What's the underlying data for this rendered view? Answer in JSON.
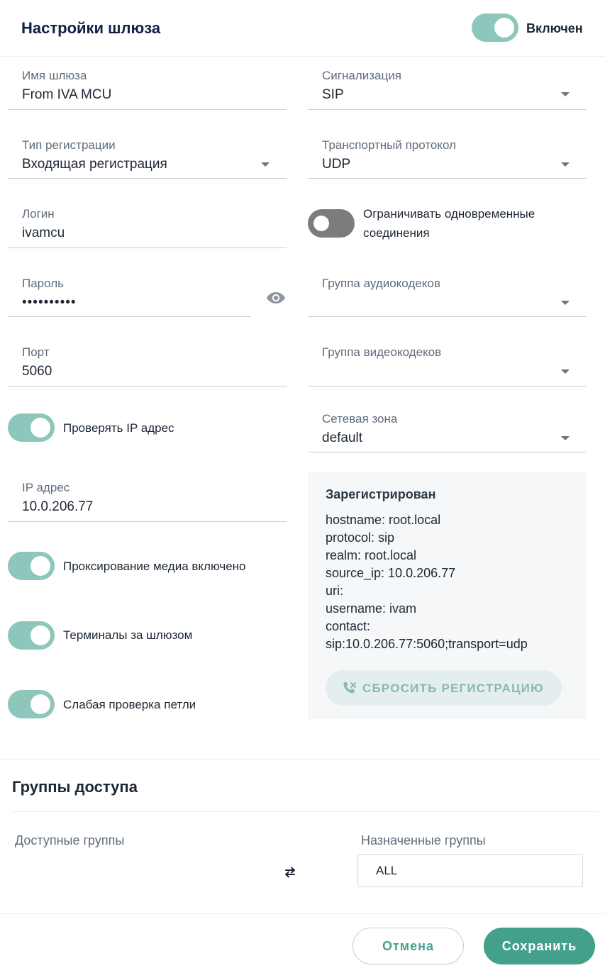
{
  "header": {
    "title": "Настройки шлюза",
    "enabled_label": "Включен",
    "enabled": true
  },
  "left": {
    "gateway_name": {
      "label": "Имя шлюза",
      "value": "From IVA MCU"
    },
    "registration_type": {
      "label": "Тип регистрации",
      "value": "Входящая регистрация"
    },
    "login": {
      "label": "Логин",
      "value": "ivamcu"
    },
    "password": {
      "label": "Пароль",
      "value": "••••••••••"
    },
    "port": {
      "label": "Порт",
      "value": "5060"
    },
    "check_ip": {
      "label": "Проверять IP адрес",
      "enabled": true
    },
    "ip_address": {
      "label": "IP адрес",
      "value": "10.0.206.77"
    },
    "media_proxy": {
      "label": "Проксирование медиа включено",
      "enabled": true
    },
    "terminals_behind": {
      "label": "Терминалы за шлюзом",
      "enabled": true
    },
    "weak_loop_check": {
      "label": "Слабая проверка петли",
      "enabled": true
    }
  },
  "right": {
    "signaling": {
      "label": "Сигнализация",
      "value": "SIP"
    },
    "transport": {
      "label": "Транспортный протокол",
      "value": "UDP"
    },
    "limit_connections": {
      "label": "Ограничивать одновременные соединения",
      "enabled": false
    },
    "audio_codecs": {
      "label": "Группа аудиокодеков",
      "value": ""
    },
    "video_codecs": {
      "label": "Группа видеокодеков",
      "value": ""
    },
    "network_zone": {
      "label": "Сетевая зона",
      "value": "default"
    }
  },
  "registration": {
    "title": "Зарегистрирован",
    "lines": [
      "hostname: root.local",
      "protocol: sip",
      "realm: root.local",
      "source_ip: 10.0.206.77",
      "uri:",
      "username: ivam",
      "contact:",
      "sip:10.0.206.77:5060;transport=udp"
    ],
    "reset_label": "СБРОСИТЬ РЕГИСТРАЦИЮ"
  },
  "access": {
    "title": "Группы доступа",
    "available_label": "Доступные группы",
    "assigned_label": "Назначенные группы",
    "assigned_items": [
      "ALL"
    ]
  },
  "footer": {
    "cancel_label": "Отмена",
    "save_label": "Сохранить"
  },
  "colors": {
    "accent": "#42a08b",
    "toggle_on": "#8dc7bb",
    "toggle_off": "#7c7c7c",
    "title": "#132045"
  },
  "icons": {
    "visibility": "eye-icon",
    "reset": "phone-reset-icon",
    "swap": "swap-arrows-icon",
    "dropdown": "caret-down-icon"
  }
}
